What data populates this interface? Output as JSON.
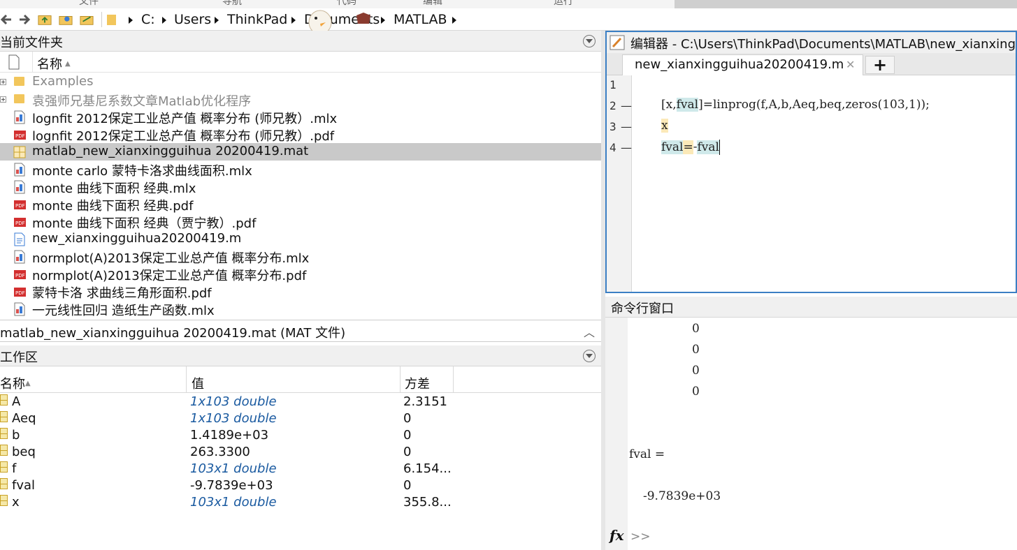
{
  "ribbon": {
    "sections": [
      "文件",
      "导航",
      "代码",
      "编辑",
      "运行"
    ]
  },
  "address": {
    "crumbs": [
      "C:",
      "Users",
      "ThinkPad",
      "Documents",
      "MATLAB"
    ]
  },
  "current_folder": {
    "title": "当前文件夹",
    "column_header": "名称",
    "items": [
      {
        "name": "Examples",
        "type": "folder"
      },
      {
        "name": "袁强师兄基尼系数文章Matlab优化程序",
        "type": "folder"
      },
      {
        "name": "lognfit 2012保定工业总产值 概率分布 (师兄教）.mlx",
        "type": "mlx"
      },
      {
        "name": "lognfit 2012保定工业总产值 概率分布 (师兄教）.pdf",
        "type": "pdf"
      },
      {
        "name": "matlab_new_xianxingguihua 20200419.mat",
        "type": "mat"
      },
      {
        "name": "monte carlo 蒙特卡洛求曲线面积.mlx",
        "type": "mlx"
      },
      {
        "name": "monte 曲线下面积 经典.mlx",
        "type": "mlx"
      },
      {
        "name": "monte 曲线下面积 经典.pdf",
        "type": "pdf"
      },
      {
        "name": "monte 曲线下面积 经典（贾宁教）.pdf",
        "type": "pdf"
      },
      {
        "name": "new_xianxingguihua20200419.m",
        "type": "m"
      },
      {
        "name": "normplot(A)2013保定工业总产值 概率分布.mlx",
        "type": "mlx"
      },
      {
        "name": "normplot(A)2013保定工业总产值 概率分布.pdf",
        "type": "pdf"
      },
      {
        "name": "蒙特卡洛 求曲线三角形面积.pdf",
        "type": "pdf"
      },
      {
        "name": "一元线性回归  造纸生产函数.mlx",
        "type": "mlx"
      }
    ],
    "pdf_badge": "PDF"
  },
  "details": {
    "text": "matlab_new_xianxingguihua 20200419.mat  (MAT 文件)"
  },
  "workspace": {
    "title": "工作区",
    "columns": [
      "名称",
      "值",
      "方差"
    ],
    "rows": [
      {
        "name": "A",
        "value": "1x103 double",
        "var": "2.3151"
      },
      {
        "name": "Aeq",
        "value": "1x103 double",
        "var": "0"
      },
      {
        "name": "b",
        "value": "1.4189e+03",
        "var": "0"
      },
      {
        "name": "beq",
        "value": "263.3300",
        "var": "0"
      },
      {
        "name": "f",
        "value": "103x1 double",
        "var": "6.154..."
      },
      {
        "name": "fval",
        "value": "-9.7839e+03",
        "var": "0"
      },
      {
        "name": "x",
        "value": "103x1 double",
        "var": "355.8..."
      }
    ]
  },
  "editor": {
    "title": "编辑器 - C:\\Users\\ThinkPad\\Documents\\MATLAB\\new_xianxinggui",
    "tab": "new_xianxingguihua20200419.m",
    "tab_close": "✕",
    "tab_add": "+",
    "line_numbers": [
      "1",
      "2",
      "3",
      "4"
    ],
    "line_marker": "—",
    "code": {
      "l2_a": "[x,",
      "l2_b": "fval",
      "l2_c": "]=linprog(f,A,b,Aeq,beq,zeros(103,1));",
      "l3": "x",
      "l4_a": "fval",
      "l4_b": "=",
      "l4_c": "-",
      "l4_d": "fval"
    }
  },
  "command": {
    "title": "命令行窗口",
    "zeros": [
      "0",
      "0",
      "0",
      "0"
    ],
    "fval_label": "fval =",
    "fval_value": "-9.7839e+03",
    "fx": "fx",
    "prompt": ">>"
  }
}
